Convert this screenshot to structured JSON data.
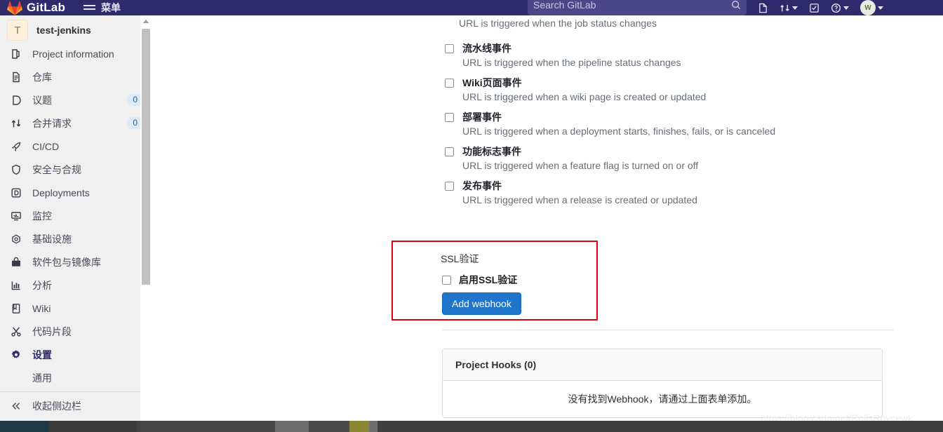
{
  "topbar": {
    "brand": "GitLab",
    "menu_label": "菜单",
    "search_placeholder": "Search GitLab",
    "icons": [
      {
        "name": "new-item-icon",
        "glyph": "new"
      },
      {
        "name": "merge-requests-icon",
        "glyph": "mr"
      },
      {
        "name": "todos-icon",
        "glyph": "todo"
      },
      {
        "name": "help-icon",
        "glyph": "help"
      }
    ],
    "avatar_initials": "W"
  },
  "sidebar": {
    "project_initial": "T",
    "project_name": "test-jenkins",
    "items": [
      {
        "label": "Project information",
        "icon": "project-information-icon",
        "badge": ""
      },
      {
        "label": "仓库",
        "icon": "repository-icon",
        "badge": ""
      },
      {
        "label": "议题",
        "icon": "issues-icon",
        "badge": "0"
      },
      {
        "label": "合并请求",
        "icon": "merge-requests-icon",
        "badge": "0"
      },
      {
        "label": "CI/CD",
        "icon": "cicd-icon",
        "badge": ""
      },
      {
        "label": "安全与合规",
        "icon": "security-shield-icon",
        "badge": ""
      },
      {
        "label": "Deployments",
        "icon": "deployments-icon",
        "badge": ""
      },
      {
        "label": "监控",
        "icon": "monitor-icon",
        "badge": ""
      },
      {
        "label": "基础设施",
        "icon": "infrastructure-cloud-icon",
        "badge": ""
      },
      {
        "label": "软件包与镜像库",
        "icon": "package-registry-icon",
        "badge": ""
      },
      {
        "label": "分析",
        "icon": "analytics-chart-icon",
        "badge": ""
      },
      {
        "label": "Wiki",
        "icon": "wiki-book-icon",
        "badge": ""
      },
      {
        "label": "代码片段",
        "icon": "snippets-scissors-icon",
        "badge": ""
      },
      {
        "label": "设置",
        "icon": "settings-gear-icon",
        "badge": "",
        "active": true
      }
    ],
    "sub_item": "通用",
    "collapse_label": "收起侧边栏"
  },
  "main": {
    "first_event_description": "URL is triggered when the job status changes",
    "events": [
      {
        "title": "流水线事件",
        "description": "URL is triggered when the pipeline status changes",
        "checked": false
      },
      {
        "title": "Wiki页面事件",
        "description": "URL is triggered when a wiki page is created or updated",
        "checked": false
      },
      {
        "title": "部署事件",
        "description": "URL is triggered when a deployment starts, finishes, fails, or is canceled",
        "checked": false
      },
      {
        "title": "功能标志事件",
        "description": "URL is triggered when a feature flag is turned on or off",
        "checked": false
      },
      {
        "title": "发布事件",
        "description": "URL is triggered when a release is created or updated",
        "checked": false
      }
    ],
    "ssl": {
      "heading": "SSL验证",
      "checkbox_label": "启用SSL验证",
      "checked": false,
      "submit_label": "Add webhook",
      "highlight_color": "#e60012"
    },
    "hooks_panel": {
      "header": "Project Hooks (0)",
      "empty_message": "没有找到Webhook，请通过上面表单添加。"
    }
  },
  "watermark": "https://blog.csdn.net/RollsRoycewk",
  "colors": {
    "navy": "#2f2a6b",
    "accent_blue": "#1f75cb",
    "sidebar_bg": "#f0f0f0",
    "annotation_red": "#e60012"
  }
}
